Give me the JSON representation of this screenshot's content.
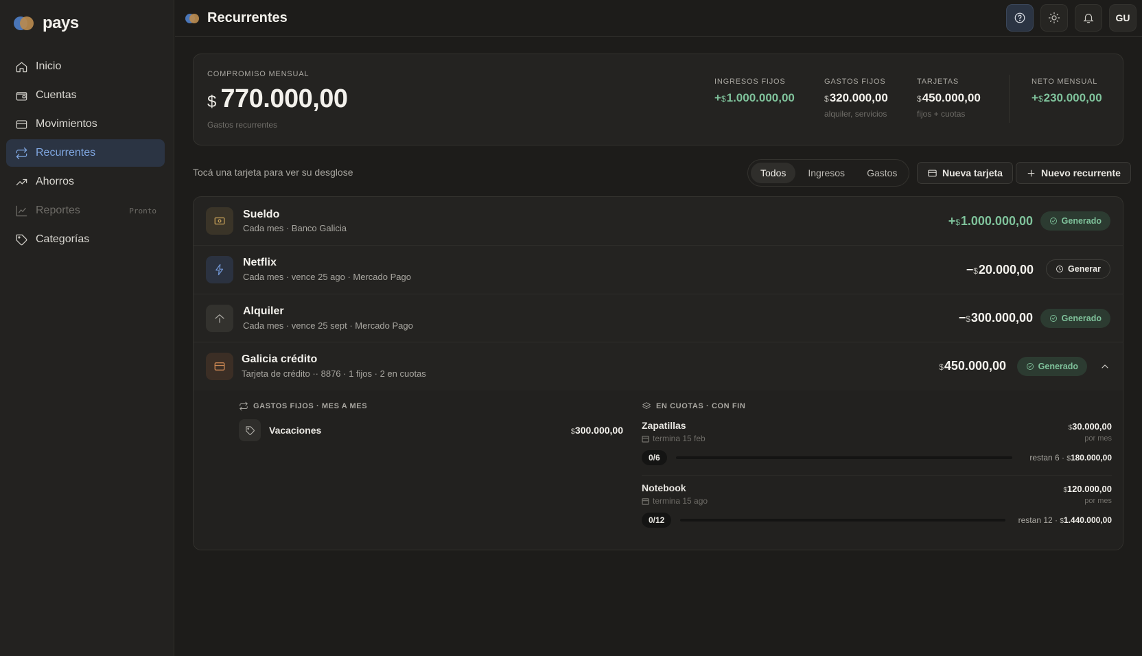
{
  "app": {
    "name": "pays"
  },
  "sidebar": {
    "items": [
      {
        "label": "Inicio",
        "icon": "home-icon"
      },
      {
        "label": "Cuentas",
        "icon": "wallet-icon"
      },
      {
        "label": "Movimientos",
        "icon": "card-icon"
      },
      {
        "label": "Recurrentes",
        "icon": "repeat-icon",
        "active": true
      },
      {
        "label": "Ahorros",
        "icon": "trending-up-icon"
      },
      {
        "label": "Reportes",
        "icon": "chart-icon",
        "disabled": true,
        "badge": "Pronto"
      },
      {
        "label": "Categorías",
        "icon": "tag-icon"
      }
    ]
  },
  "header": {
    "title": "Recurrentes",
    "avatar_initials": "GU"
  },
  "summary": {
    "label": "COMPROMISO MENSUAL",
    "currency": "$",
    "value": "770.000,00",
    "sub": "Gastos recurrentes",
    "kpis": [
      {
        "label": "INGRESOS FIJOS",
        "sign": "+",
        "currency": "$",
        "value": "1.000.000,00",
        "sub": "",
        "positive": true
      },
      {
        "label": "GASTOS FIJOS",
        "sign": "",
        "currency": "$",
        "value": "320.000,00",
        "sub": "alquiler, servicios"
      },
      {
        "label": "TARJETAS",
        "sign": "",
        "currency": "$",
        "value": "450.000,00",
        "sub": "fijos + cuotas"
      },
      {
        "label": "NETO MENSUAL",
        "sign": "+",
        "currency": "$",
        "value": "230.000,00",
        "sub": "",
        "positive": true
      }
    ]
  },
  "toolbar": {
    "hint": "Tocá una tarjeta para ver su desglose",
    "filters": [
      "Todos",
      "Ingresos",
      "Gastos"
    ],
    "active_filter": "Todos",
    "new_card_label": "Nueva tarjeta",
    "new_recurrent_label": "Nuevo recurrente"
  },
  "rows": [
    {
      "title": "Sueldo",
      "sub": "Cada mes · Banco Galicia",
      "sign": "+",
      "currency": "$",
      "amount": "1.000.000,00",
      "status": "Generado",
      "icon": "money-icon",
      "icon_color": "#c9a35a",
      "icon_bg": "#3a3428"
    },
    {
      "title": "Netflix",
      "sub": "Cada mes · vence 25 ago · Mercado Pago",
      "sign": "−",
      "currency": "$",
      "amount": "20.000,00",
      "status": "Generar",
      "icon": "bolt-icon",
      "icon_color": "#6f93cf",
      "icon_bg": "#2b3240"
    },
    {
      "title": "Alquiler",
      "sub": "Cada mes · vence 25 sept · Mercado Pago",
      "sign": "−",
      "currency": "$",
      "amount": "300.000,00",
      "status": "Generado",
      "icon": "house-icon",
      "icon_color": "#a9a7a1",
      "icon_bg": "#33322e"
    },
    {
      "title": "Galicia crédito",
      "sub": "Tarjeta de crédito ·· 8876 · 1 fijos · 2 en cuotas",
      "sign": "",
      "currency": "$",
      "amount": "450.000,00",
      "status": "Generado",
      "icon": "credit-card-icon",
      "icon_color": "#d08a55",
      "icon_bg": "#3b2e25"
    }
  ],
  "expanded": {
    "fixed_heading": "GASTOS FIJOS · MES A MES",
    "installments_heading": "EN CUOTAS · CON FIN",
    "fixed": [
      {
        "name": "Vacaciones",
        "currency": "$",
        "amount": "300.000,00"
      }
    ],
    "installments": [
      {
        "name": "Zapatillas",
        "ends": "termina 15 feb",
        "currency": "$",
        "amount": "30.000,00",
        "per": "por mes",
        "progress_label": "0/6",
        "progress": 0,
        "remaining_label": "restan 6 ·",
        "remaining_amount": "180.000,00"
      },
      {
        "name": "Notebook",
        "ends": "termina 15 ago",
        "currency": "$",
        "amount": "120.000,00",
        "per": "por mes",
        "progress_label": "0/12",
        "progress": 0,
        "remaining_label": "restan 12 ·",
        "remaining_amount": "1.440.000,00"
      }
    ]
  },
  "colors": {
    "accent": "#7fa6e0",
    "positive": "#7fc29b",
    "background": "#1d1c1a"
  }
}
